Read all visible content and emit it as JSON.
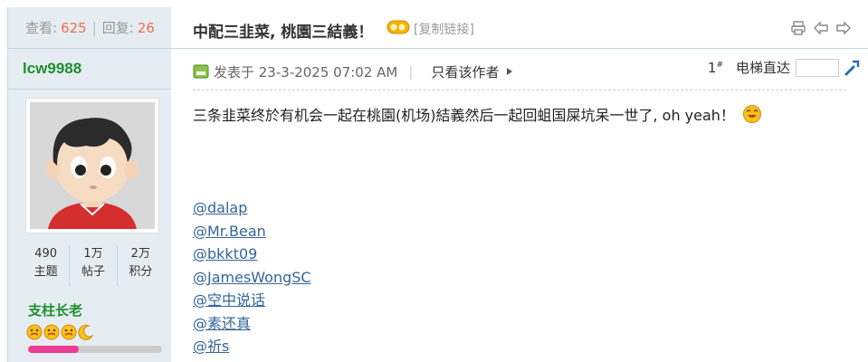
{
  "stats": {
    "views_label": "查看:",
    "views": "625",
    "replies_label": "回复:",
    "replies": "26"
  },
  "thread": {
    "title": "中配三韭菜, 桃園三結義！",
    "copy_link": "[复制链接]"
  },
  "author": {
    "name": "lcw9988",
    "counts": [
      {
        "value": "490",
        "label": "主题"
      },
      {
        "value": "1万",
        "label": "帖子"
      },
      {
        "value": "2万",
        "label": "积分"
      }
    ],
    "rank": "支柱长老",
    "rank_progress": 0.38,
    "rank_icons": [
      "face-icon",
      "face-icon",
      "face-icon",
      "moon-icon"
    ]
  },
  "post": {
    "posted_label": "发表于 23-3-2025 07:02 AM",
    "author_only": "只看该作者",
    "floor": "1",
    "floor_sup": "#",
    "jump_label": "电梯直达",
    "body": "三条韭菜终於有机会一起在桃園(机场)結義然后一起回蛆国屎坑呆一世了, oh yeah！",
    "mentions": [
      "@dalap",
      "@Mr.Bean",
      "@bkkt09",
      "@JamesWongSC",
      "@空中说话",
      "@素还真",
      "@祈s"
    ]
  },
  "colors": {
    "accent_number": "#f26c4f",
    "username_green": "#1f8f2e",
    "sidebar_bg": "#e5edf2",
    "link_blue": "#336699",
    "progress_pink": "#ec3b94"
  }
}
